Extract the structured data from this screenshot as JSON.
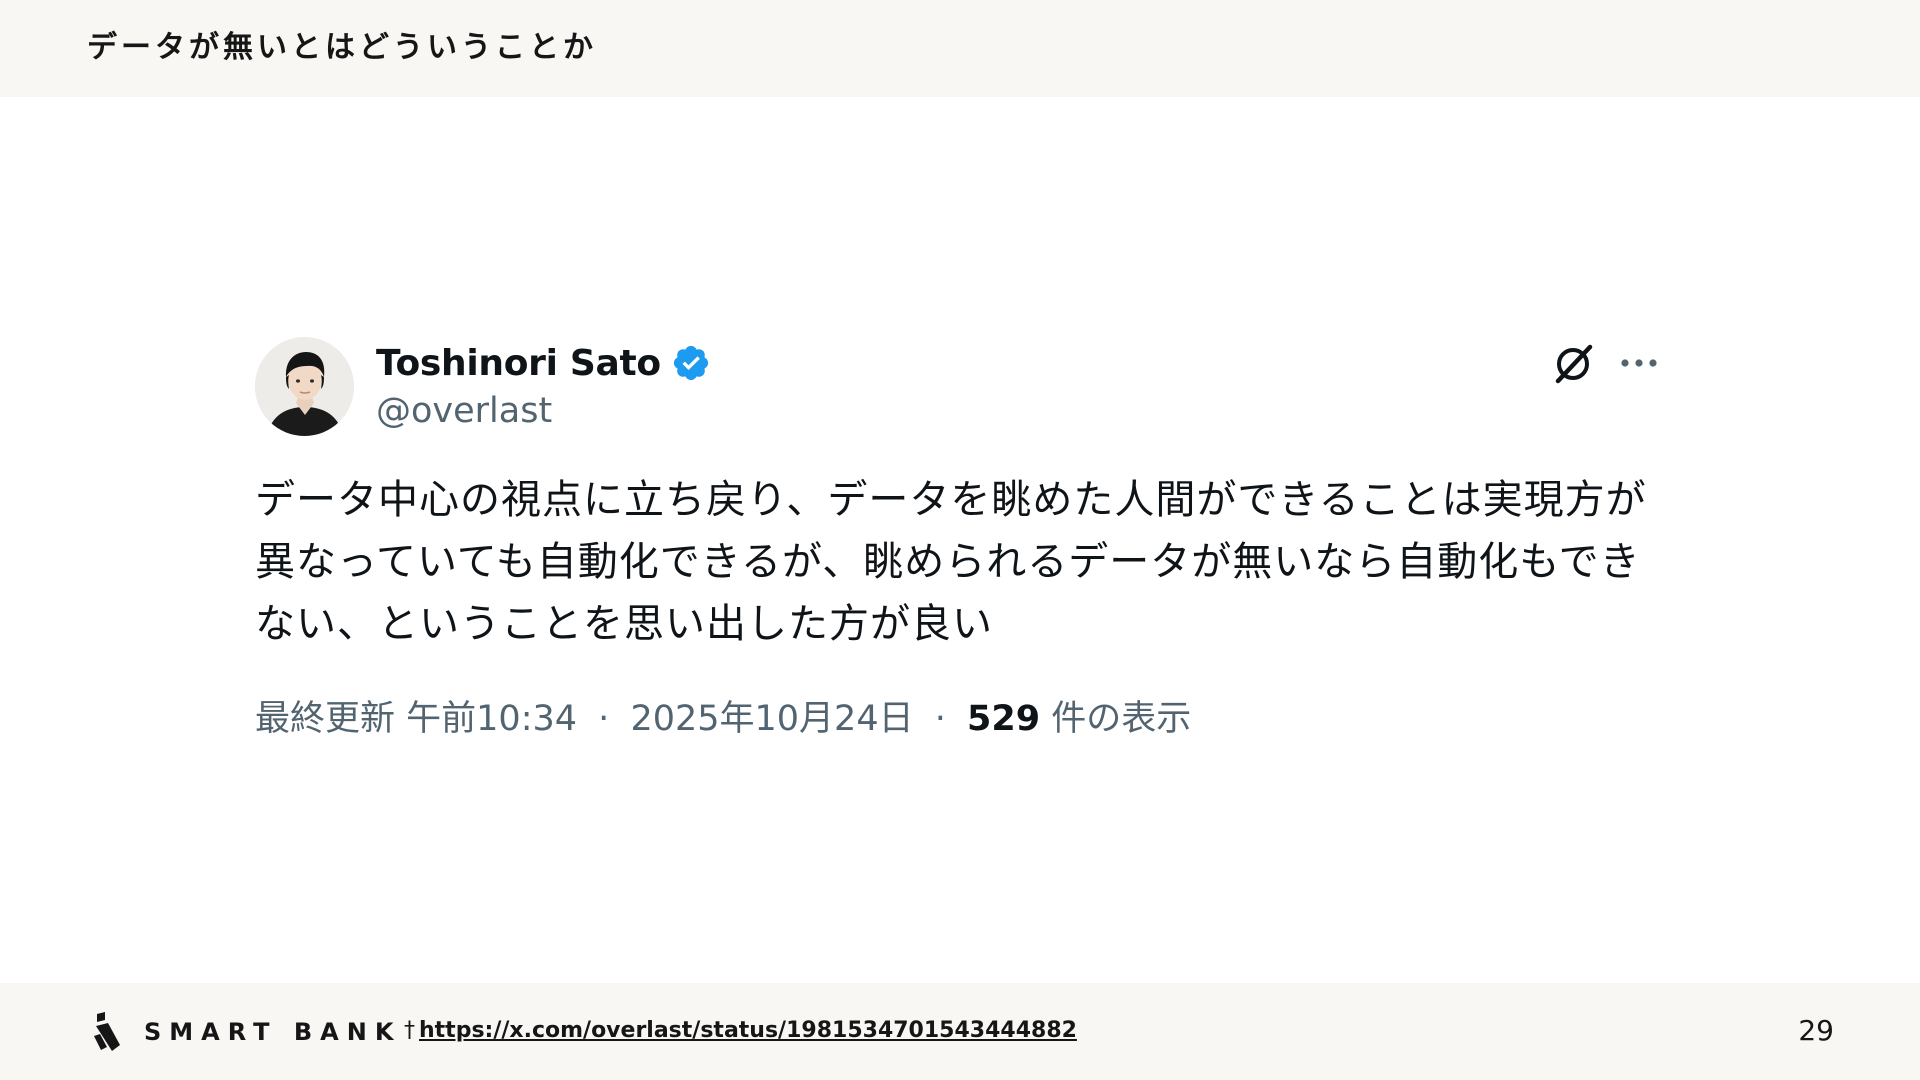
{
  "slide": {
    "title": "データが無いとはどういうことか",
    "page_number": "29"
  },
  "tweet": {
    "author": {
      "display_name": "Toshinori Sato",
      "handle": "@overlast",
      "verified": true,
      "verified_color": "#1d9bf0"
    },
    "text": "データ中心の視点に立ち戻り、データを眺めた人間ができることは実現方が異なっていても自動化できるが、眺められるデータが無いなら自動化もできない、ということを思い出した方が良い",
    "meta": {
      "edited_label": "最終更新",
      "time": "午前10:34",
      "separator": "·",
      "date": "2025年10月24日",
      "views_count": "529",
      "views_label": "件の表示"
    },
    "icons": [
      "grok-icon",
      "more-icon"
    ]
  },
  "footer": {
    "logo_text": "SMART BANK",
    "source_dagger": "†",
    "source_url": "https://x.com/overlast/status/1981534701543444882"
  },
  "colors": {
    "band_background": "#f8f7f3",
    "text_primary": "#0f1419",
    "text_secondary": "#536471",
    "accent_verified": "#1d9bf0"
  }
}
